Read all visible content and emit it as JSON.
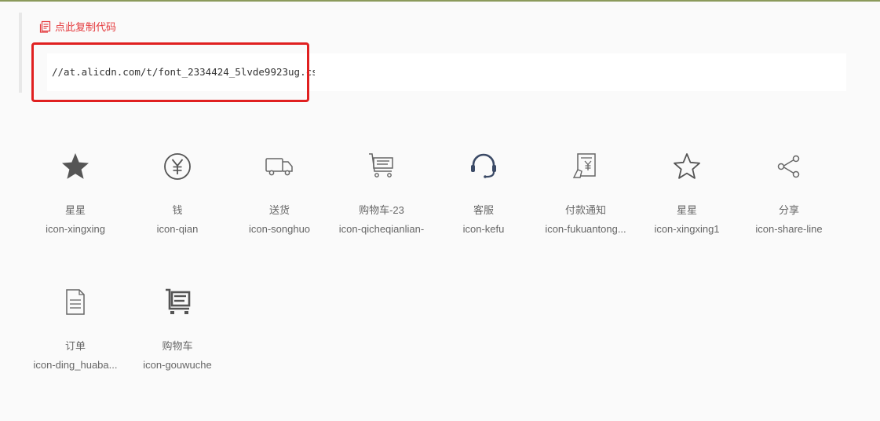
{
  "copy_link": {
    "label": "点此复制代码",
    "icon": "copy-icon"
  },
  "code": {
    "text": "//at.alicdn.com/t/font_2334424_5lvde9923ug.css"
  },
  "icons": [
    {
      "name": "星星",
      "code": "icon-xingxing",
      "icon": "star-filled-icon"
    },
    {
      "name": "钱",
      "code": "icon-qian",
      "icon": "yen-icon"
    },
    {
      "name": "送货",
      "code": "icon-songhuo",
      "icon": "truck-icon"
    },
    {
      "name": "购物车-23",
      "code": "icon-qicheqianlian-",
      "icon": "shopping-cart-icon"
    },
    {
      "name": "客服",
      "code": "icon-kefu",
      "icon": "headset-icon"
    },
    {
      "name": "付款通知",
      "code": "icon-fukuantong...",
      "icon": "payment-notice-icon"
    },
    {
      "name": "星星",
      "code": "icon-xingxing1",
      "icon": "star-outline-icon"
    },
    {
      "name": "分享",
      "code": "icon-share-line",
      "icon": "share-icon"
    },
    {
      "name": "订单",
      "code": "icon-ding_huaba...",
      "icon": "order-document-icon"
    },
    {
      "name": "购物车",
      "code": "icon-gouwuche",
      "icon": "cart-icon"
    }
  ]
}
